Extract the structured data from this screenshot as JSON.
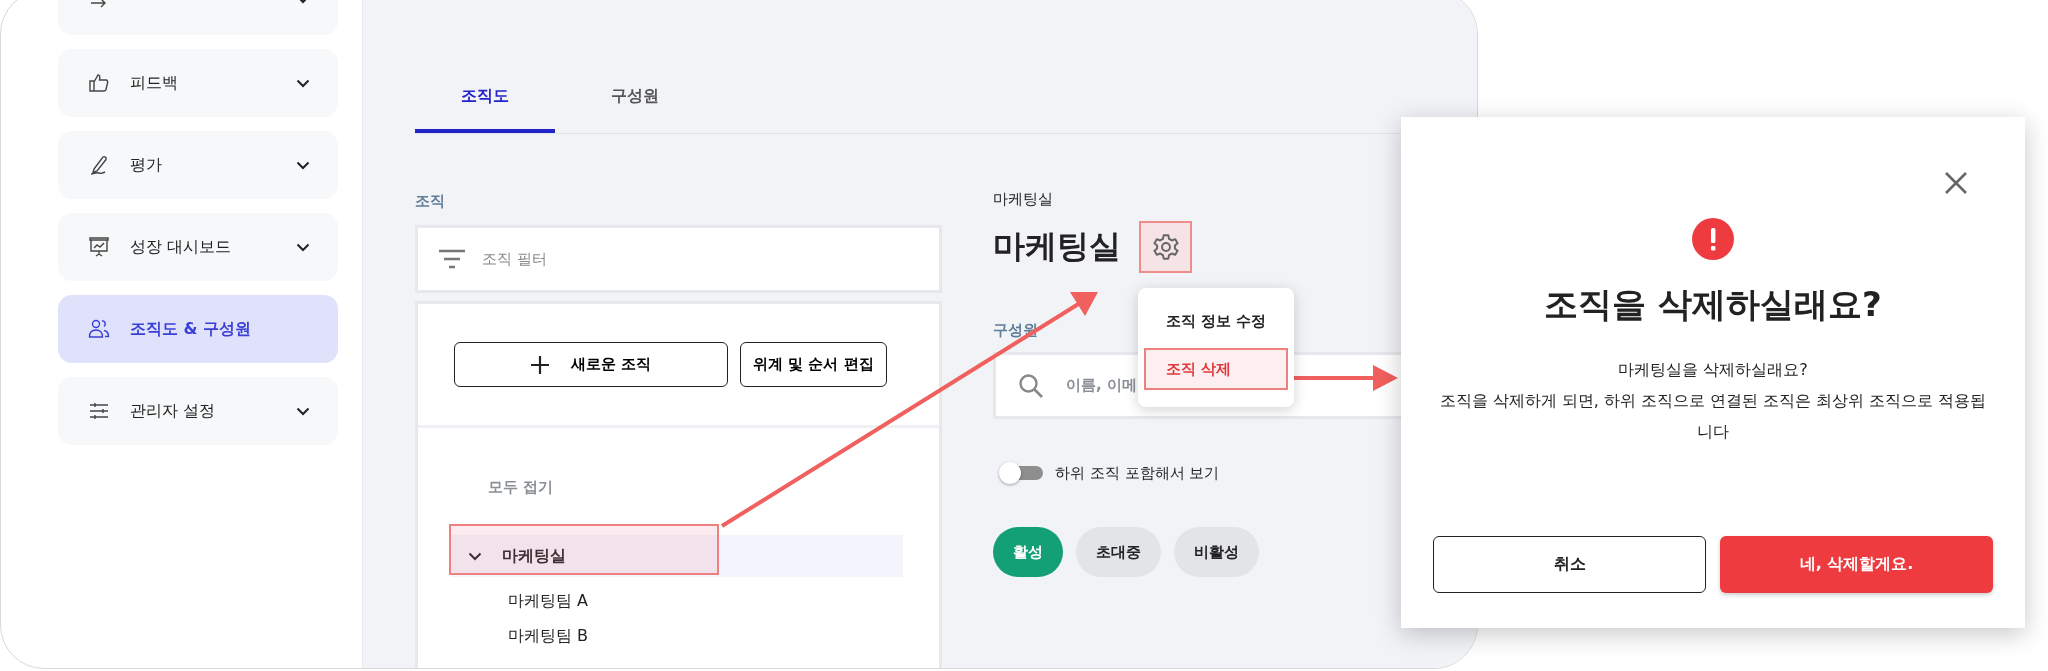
{
  "sidebar": {
    "items": [
      {
        "kind": "cut",
        "selected": false,
        "expandable": true
      },
      {
        "kind": "normal",
        "label": "피드백",
        "selected": false,
        "expandable": true
      },
      {
        "kind": "normal",
        "label": "평가",
        "selected": false,
        "expandable": true
      },
      {
        "kind": "normal",
        "label": "성장 대시보드",
        "selected": false,
        "expandable": true
      },
      {
        "kind": "normal",
        "label": "조직도 & 구성원",
        "selected": true,
        "expandable": false
      },
      {
        "kind": "normal",
        "label": "관리자 설정",
        "selected": false,
        "expandable": true
      }
    ]
  },
  "tabs": [
    {
      "label": "조직도",
      "selected": true
    },
    {
      "label": "구성원",
      "selected": false
    }
  ],
  "org_panel": {
    "label": "조직",
    "filter_placeholder": "조직 필터",
    "buttons": [
      {
        "label": "새로운 조직"
      },
      {
        "label": "위계 및 순서 편집"
      }
    ],
    "collapse_all": "모두 접기",
    "tree": [
      {
        "label": "마케팅실",
        "expanded": true,
        "selected": true,
        "children": [
          {
            "label": "마케팅팀 A",
            "selected": false
          },
          {
            "label": "마케팅팀 B",
            "selected": false
          }
        ]
      }
    ]
  },
  "detail": {
    "breadcrumb": "마케팅실",
    "title": "마케팅실",
    "members_label": "구성원",
    "search_placeholder": "이름, 이메",
    "include_sub": {
      "label": "하위 조직 포함해서 보기",
      "on": false
    },
    "status_chips": [
      {
        "label": "활성",
        "selected": true
      },
      {
        "label": "초대중",
        "selected": false
      },
      {
        "label": "비활성",
        "selected": false
      }
    ]
  },
  "menu": {
    "items": [
      {
        "label": "조직 정보 수정",
        "kind": "normal"
      },
      {
        "label": "조직 삭제",
        "kind": "danger"
      }
    ]
  },
  "dialog": {
    "title": "조직을 삭제하실래요?",
    "message": [
      "마케팅실을 삭제하실래요?",
      "조직을 삭제하게 되면, 하위 조직으로 연결된 조직은 최상위 조직으로 적용됩니다"
    ],
    "buttons": [
      {
        "label": "취소",
        "kind": "secondary"
      },
      {
        "label": "네, 삭제할게요.",
        "kind": "danger"
      }
    ]
  }
}
